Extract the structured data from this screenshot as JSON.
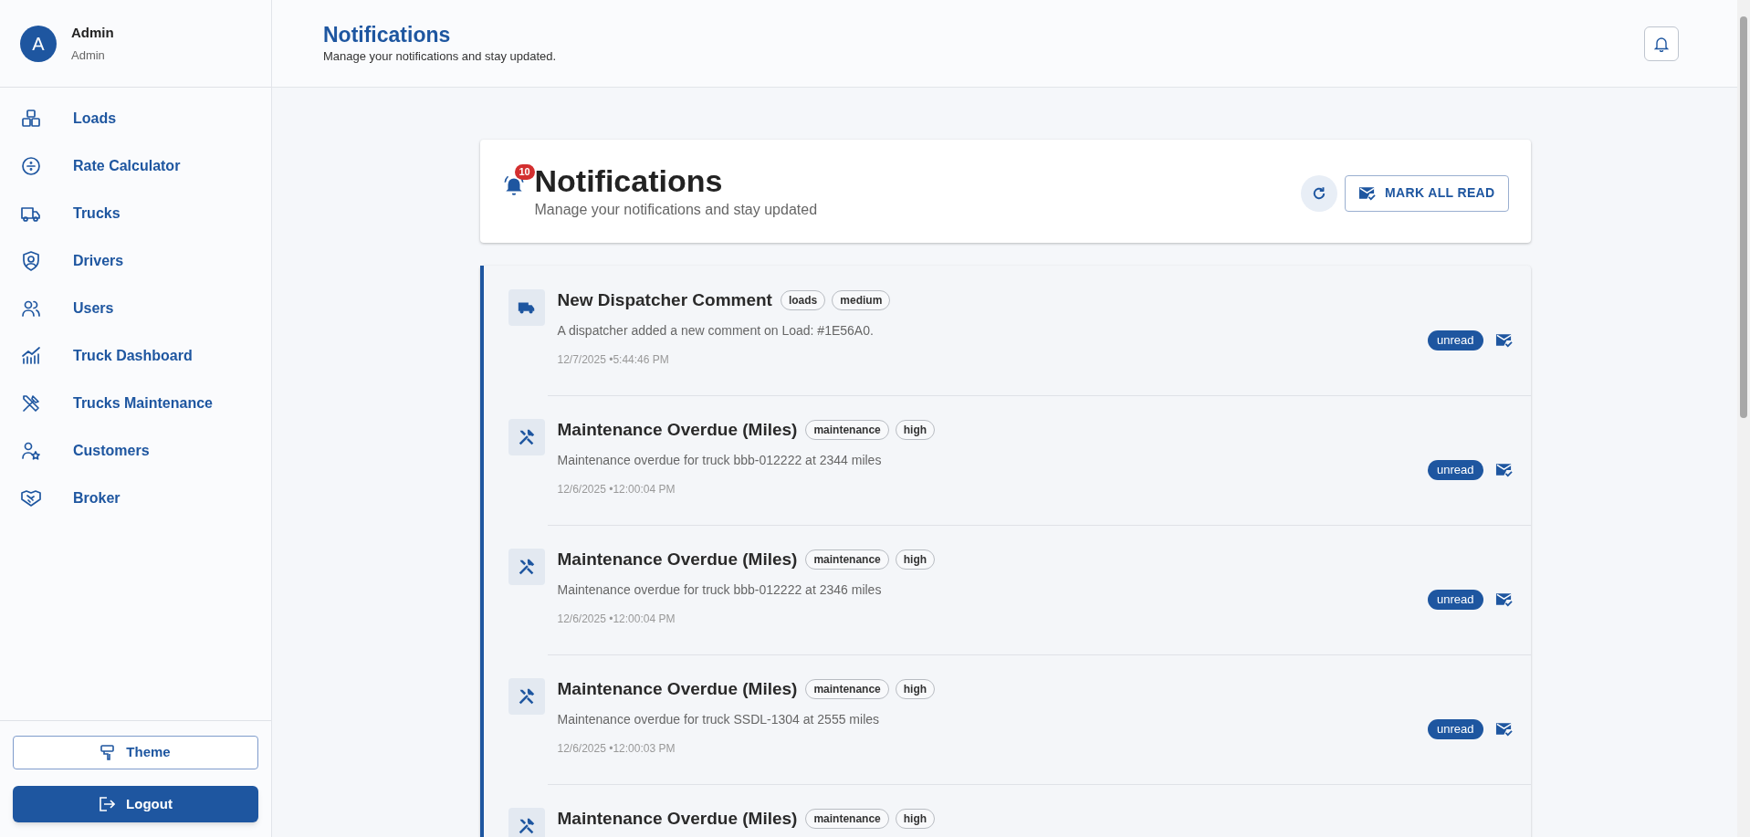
{
  "user": {
    "initial": "A",
    "name": "Admin",
    "role": "Admin"
  },
  "sidebar": {
    "items": [
      {
        "label": "Loads"
      },
      {
        "label": "Rate Calculator"
      },
      {
        "label": "Trucks"
      },
      {
        "label": "Drivers"
      },
      {
        "label": "Users"
      },
      {
        "label": "Truck Dashboard"
      },
      {
        "label": "Trucks Maintenance"
      },
      {
        "label": "Customers"
      },
      {
        "label": "Broker"
      }
    ],
    "theme_button": "Theme",
    "logout_button": "Logout"
  },
  "header": {
    "title": "Notifications",
    "subtitle": "Manage your notifications and stay updated."
  },
  "panel": {
    "badge_count": "10",
    "title": "Notifications",
    "subtitle": "Manage your notifications and stay updated",
    "mark_all_button": "MARK ALL READ"
  },
  "notifications": [
    {
      "kind": "truck",
      "unread": true,
      "title": "New Dispatcher Comment",
      "tags": [
        "loads",
        "medium"
      ],
      "message": "A dispatcher added a new comment on Load: #1E56A0.",
      "time": "12/7/2025 •5:44:46 PM",
      "status": "unread"
    },
    {
      "kind": "tools",
      "unread": true,
      "title": "Maintenance Overdue (Miles)",
      "tags": [
        "maintenance",
        "high"
      ],
      "message": "Maintenance overdue for truck bbb-012222 at 2344 miles",
      "time": "12/6/2025 •12:00:04 PM",
      "status": "unread"
    },
    {
      "kind": "tools",
      "unread": true,
      "title": "Maintenance Overdue (Miles)",
      "tags": [
        "maintenance",
        "high"
      ],
      "message": "Maintenance overdue for truck bbb-012222 at 2346 miles",
      "time": "12/6/2025 •12:00:04 PM",
      "status": "unread"
    },
    {
      "kind": "tools",
      "unread": true,
      "title": "Maintenance Overdue (Miles)",
      "tags": [
        "maintenance",
        "high"
      ],
      "message": "Maintenance overdue for truck SSDL-1304 at 2555 miles",
      "time": "12/6/2025 •12:00:03 PM",
      "status": "unread"
    },
    {
      "kind": "tools",
      "unread": true,
      "title": "Maintenance Overdue (Miles)",
      "tags": [
        "maintenance",
        "high"
      ]
    }
  ]
}
